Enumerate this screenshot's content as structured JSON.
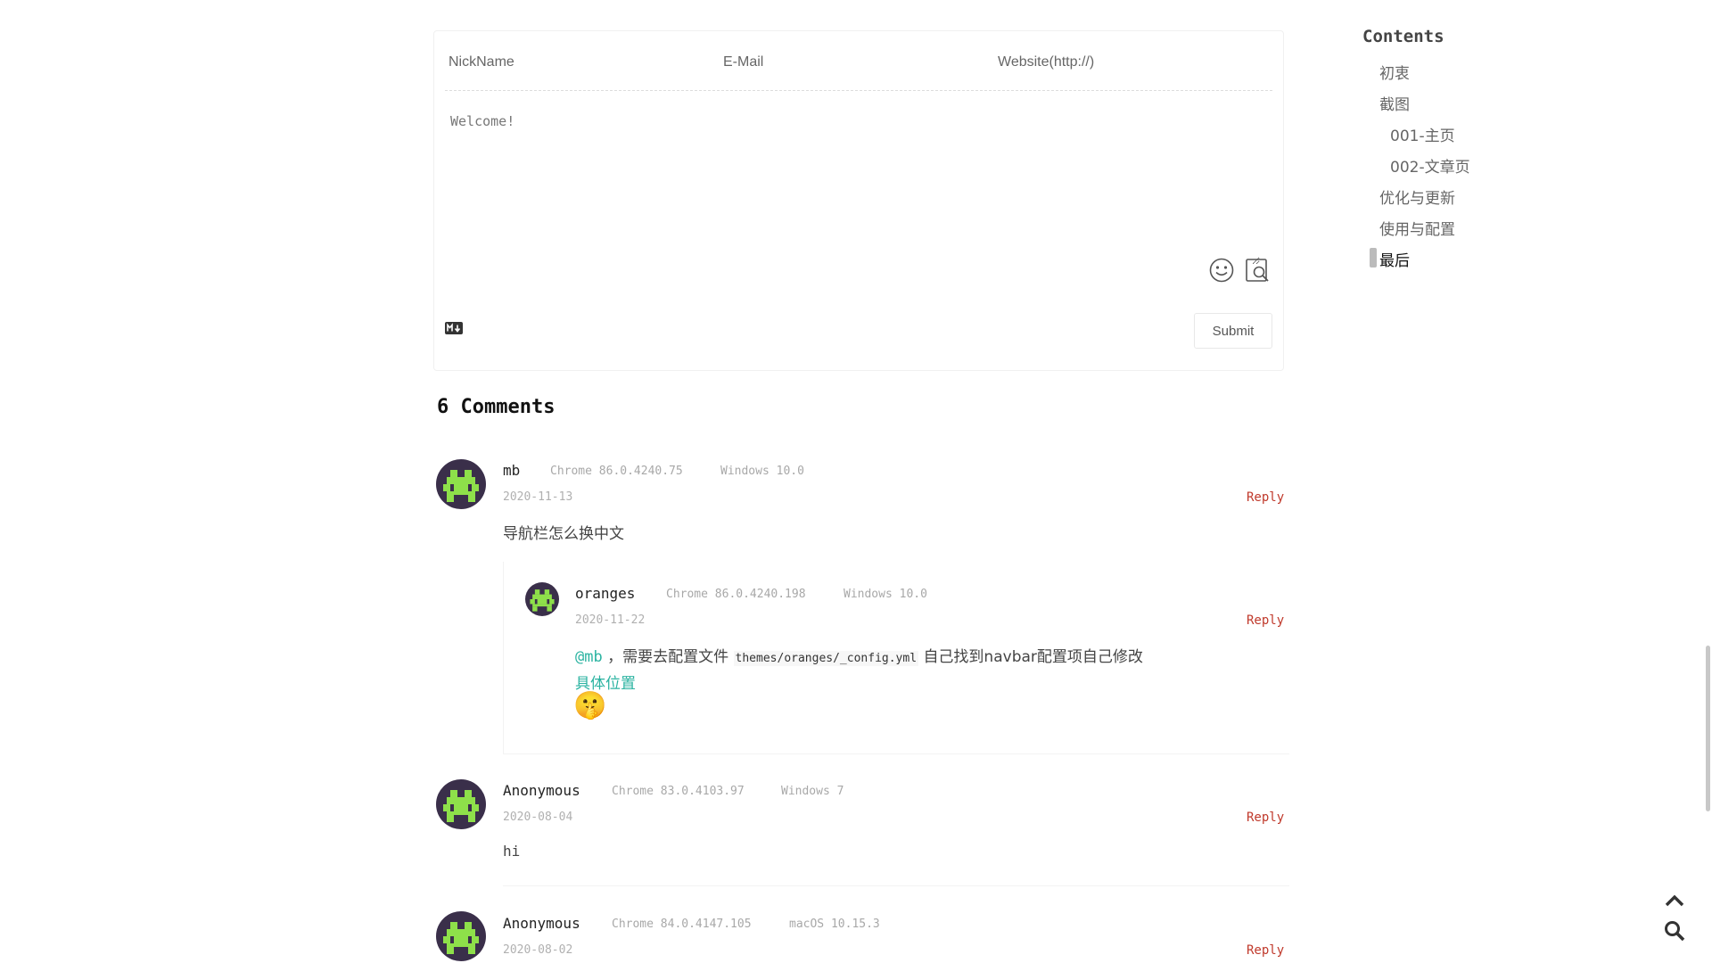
{
  "form": {
    "nick_placeholder": "NickName",
    "mail_placeholder": "E-Mail",
    "website_placeholder": "Website(http://)",
    "textarea_placeholder": "Welcome!",
    "submit_label": "Submit"
  },
  "comments_heading": "6 Comments",
  "comments": [
    {
      "nick": "mb",
      "browser": "Chrome 86.0.4240.75",
      "os": "Windows 10.0",
      "date": "2020-11-13",
      "reply": "Reply",
      "text": "导航栏怎么换中文"
    },
    {
      "nick": "oranges",
      "browser": "Chrome 86.0.4240.198",
      "os": "Windows 10.0",
      "date": "2020-11-22",
      "reply": "Reply",
      "mention": "@mb",
      "text_a": "，需要去配置文件",
      "code": "themes/oranges/_config.yml",
      "text_b": "自己找到navbar配置项自己修改",
      "link": "具体位置",
      "emoji": "🤫"
    },
    {
      "nick": "Anonymous",
      "browser": "Chrome 83.0.4103.97",
      "os": "Windows 7",
      "date": "2020-08-04",
      "reply": "Reply",
      "text": "hi"
    },
    {
      "nick": "Anonymous",
      "browser": "Chrome 84.0.4147.105",
      "os": "macOS 10.15.3",
      "date": "2020-08-02",
      "reply": "Reply"
    }
  ],
  "toc": {
    "title": "Contents",
    "items": [
      "初衷",
      "截图",
      "001-主页",
      "002-文章页",
      "优化与更新",
      "使用与配置",
      "最后"
    ]
  },
  "icons": {
    "emoji_button": "smiley-icon",
    "preview_button": "preview-icon",
    "markdown_badge": "markdown-icon",
    "back_to_top": "arrow-up-icon",
    "search": "search-icon"
  },
  "colors": {
    "reply": "#c0392b",
    "mention": "#2bb3a1",
    "avatar_bg": "#3a2f4a",
    "avatar_fg": "#8ee04a"
  }
}
